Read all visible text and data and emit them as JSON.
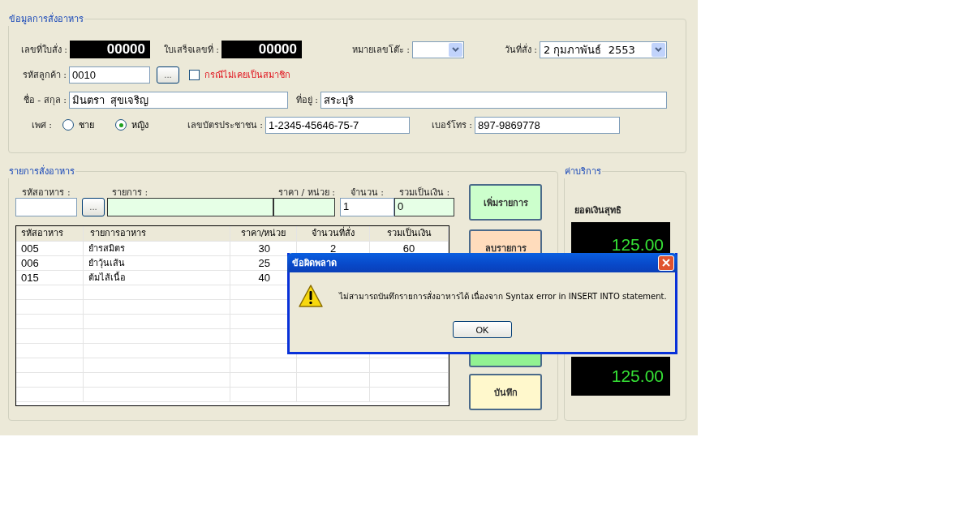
{
  "order_info": {
    "legend": "ข้อมูลการสั่งอาหาร",
    "order_no": {
      "label": "เลขที่ใบสั่ง :",
      "value": "00000"
    },
    "receipt_no": {
      "label": "ใบเสร็จเลขที่ :",
      "value": "00000"
    },
    "table_no": {
      "label": "หมายเลขโต๊ะ :"
    },
    "order_date": {
      "label": "วันที่สั่ง :",
      "value": "2 กุมภาพันธ์  2553"
    },
    "customer_code": {
      "label": "รหัสลูกค้า :",
      "value": "0010",
      "browse": "..."
    },
    "non_member": {
      "label": "กรณีไม่เคยเป็นสมาชิก",
      "checked": false
    },
    "name": {
      "label": "ชื่อ - สกุล :",
      "value": "มินตรา  สุขเจริญ"
    },
    "address": {
      "label": "ที่อยู่ :",
      "value": "สระบุริ"
    },
    "gender": {
      "label": "เพศ :",
      "options": [
        {
          "label": "ชาย",
          "selected": false
        },
        {
          "label": "หญิง",
          "selected": true
        }
      ]
    },
    "id_card": {
      "label": "เลขบัตรประชาชน :",
      "value": "1-2345-45646-75-7"
    },
    "phone": {
      "label": "เบอร์โทร :",
      "value": "897-9869778"
    }
  },
  "order_items": {
    "legend": "รายการสั่งอาหาร",
    "entry": [
      {
        "label": "รหัสอาหาร :",
        "kind": "plain",
        "browse": "..."
      },
      {
        "label": "รายการ :",
        "kind": "readonly"
      },
      {
        "label": "ราคา / หน่วย :",
        "kind": "readonly"
      },
      {
        "label": "จำนวน :",
        "kind": "plain",
        "value": "1"
      },
      {
        "label": "รวมเป็นเงิน :",
        "kind": "readonly",
        "value": "0"
      }
    ],
    "table": {
      "columns": [
        "รหัสอาหาร",
        "รายการอาหาร",
        "ราคา/หน่วย",
        "จำนวนที่สั่ง",
        "รวมเป็นเงิน"
      ],
      "rows": [
        [
          "005",
          "ยำรสมิตร",
          "30",
          "2",
          "60"
        ],
        [
          "006",
          "ยำวุ้นเส้น",
          "25",
          "",
          ""
        ],
        [
          "015",
          "ต้มไส้เนื้อ",
          "40",
          "",
          ""
        ]
      ]
    },
    "buttons": [
      {
        "label": "เพิ่มรายการ",
        "kind": "add"
      },
      {
        "label": "ลบรายการ",
        "kind": "delete"
      },
      {
        "kind": "confirm"
      },
      {
        "label": "บันทึก",
        "kind": "save"
      }
    ]
  },
  "services": {
    "legend": "ค่าบริการ",
    "net_label": "ยอดเงินสุทธิ",
    "displays": [
      "125.00",
      "125.00"
    ]
  },
  "dialog": {
    "title": "ข้อผิดพลาด",
    "message": "ไม่สามารถบันทึกรายการสั่งอาหารได้ เนื่องจาก Syntax error in INSERT INTO statement.",
    "button": "OK"
  }
}
